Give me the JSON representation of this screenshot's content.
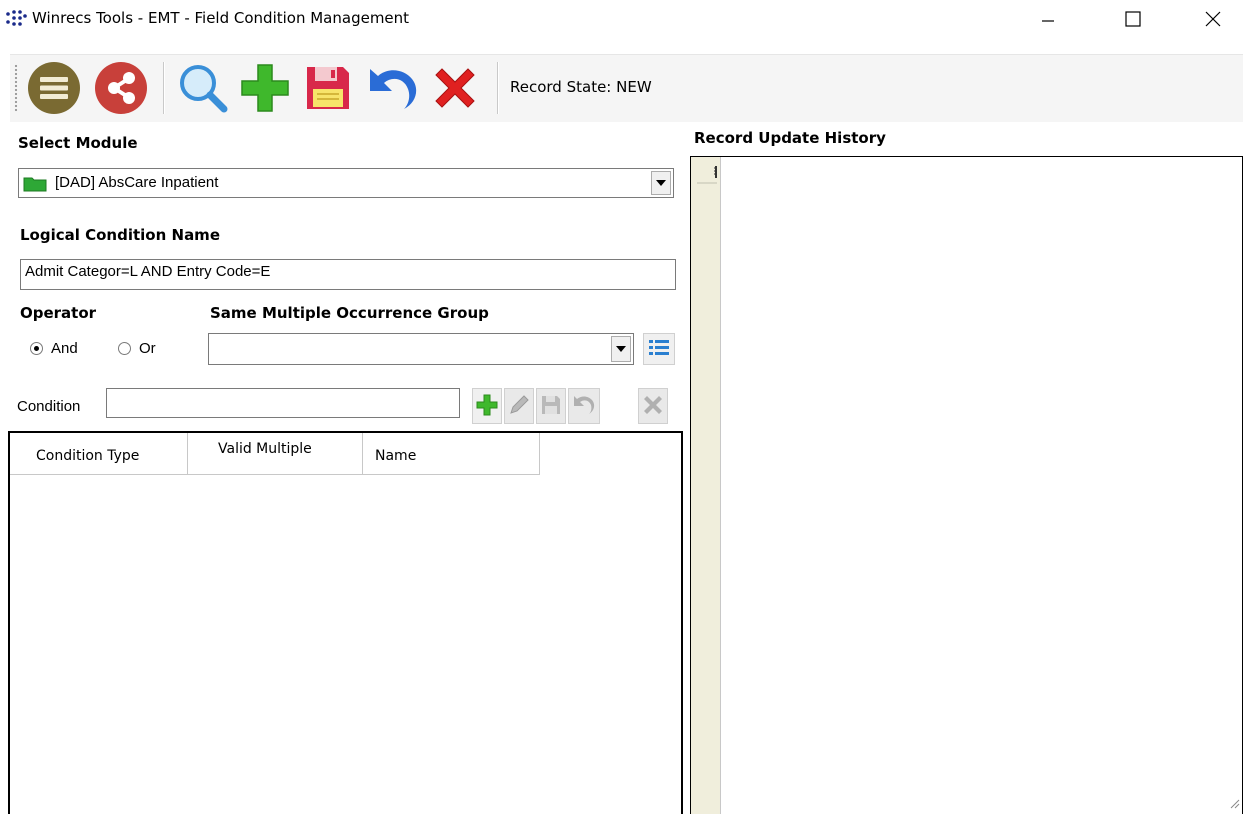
{
  "window": {
    "title": "Winrecs Tools - EMT - Field Condition Management",
    "controls": [
      "minimize",
      "maximize",
      "close"
    ]
  },
  "toolbar": {
    "buttons": [
      {
        "name": "list-icon",
        "color": "#7a6a32"
      },
      {
        "name": "share-icon",
        "color": "#c8403a"
      },
      {
        "name": "search-icon",
        "color": "#3a8fd8"
      },
      {
        "name": "add-icon",
        "color": "#3fb82c"
      },
      {
        "name": "save-icon",
        "color": "#d8284a"
      },
      {
        "name": "undo-icon",
        "color": "#2a6cd6"
      },
      {
        "name": "delete-icon",
        "color": "#e02020"
      }
    ],
    "record_state": "Record State: NEW"
  },
  "module": {
    "label": "Select Module",
    "value": "[DAD] AbsCare Inpatient"
  },
  "logical_condition": {
    "label": "Logical Condition Name",
    "value": "Admit Categor=L AND Entry Code=E"
  },
  "operator": {
    "label": "Operator",
    "options": [
      {
        "label": "And",
        "selected": true
      },
      {
        "label": "Or",
        "selected": false
      }
    ]
  },
  "occurrence_group": {
    "label": "Same Multiple Occurrence Group",
    "value": ""
  },
  "condition": {
    "label": "Condition",
    "value": ""
  },
  "grid": {
    "columns": [
      "Condition Type",
      "Valid Multiple",
      "Name"
    ],
    "rows": []
  },
  "history": {
    "label": "Record Update History"
  }
}
